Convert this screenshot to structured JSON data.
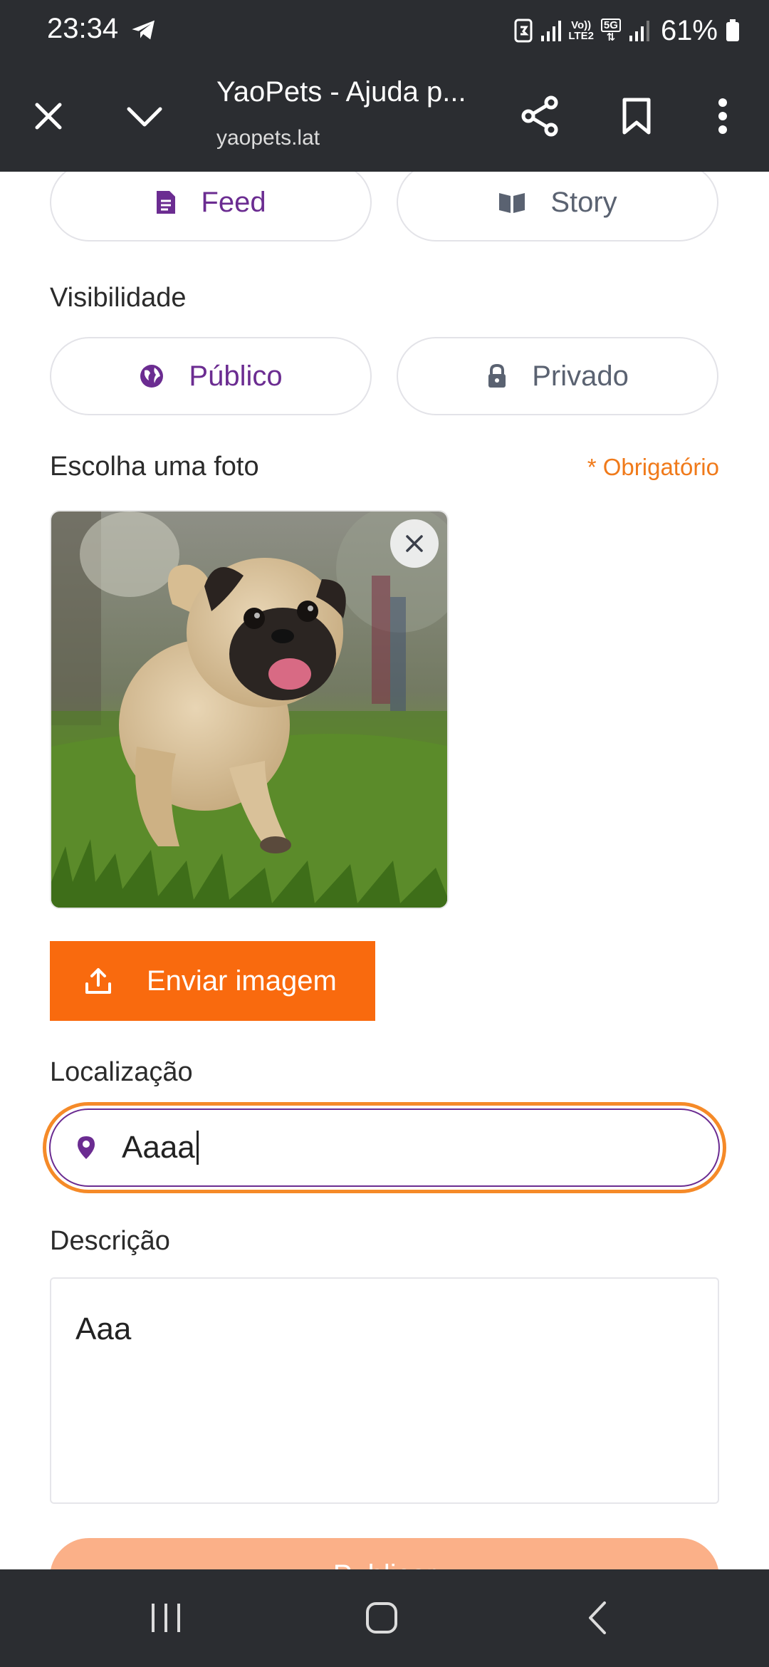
{
  "status_bar": {
    "time": "23:34",
    "network_label_top": "Vo))",
    "network_label_bottom": "LTE2",
    "network_5g": "5G",
    "battery": "61%"
  },
  "browser": {
    "title": "YaoPets - Ajuda p...",
    "url": "yaopets.lat"
  },
  "post_type": {
    "feed_label": "Feed",
    "story_label": "Story",
    "selected": "Feed"
  },
  "visibility": {
    "label": "Visibilidade",
    "public_label": "Público",
    "private_label": "Privado",
    "selected": "Público"
  },
  "photo": {
    "label": "Escolha uma foto",
    "required": "* Obrigatório",
    "upload_button": "Enviar imagem"
  },
  "location": {
    "label": "Localização",
    "value": "Aaaa"
  },
  "description": {
    "label": "Descrição",
    "value": "Aaa"
  },
  "publish_button": "Publicar",
  "colors": {
    "accent_purple": "#6b2c91",
    "accent_orange": "#f96a0e",
    "chrome_dark": "#2b2d31"
  }
}
